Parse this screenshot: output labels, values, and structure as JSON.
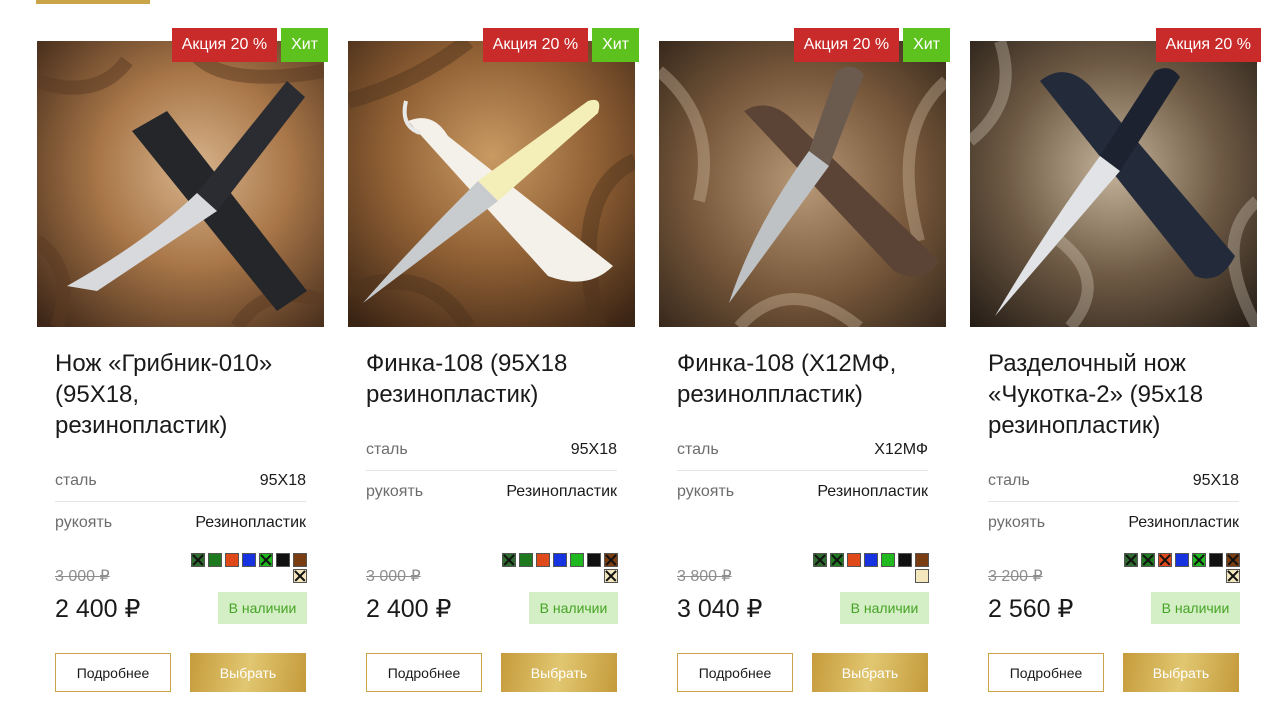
{
  "colors": {
    "accent": "#c9a449",
    "sale_badge": "#c92a2a",
    "hit_badge": "#5dc21e",
    "stock_bg": "#d4efc6",
    "stock_text": "#45a325"
  },
  "products": [
    {
      "badge_sale": "Акция 20 %",
      "badge_hit": "Хит",
      "image_icon": "knife-photo-icon",
      "title": "Нож «Грибник-010» (95Х18, резинопластик)",
      "specs": [
        {
          "name": "сталь",
          "value": "95Х18"
        },
        {
          "name": "рукоять",
          "value": "Резинопластик"
        }
      ],
      "swatches": [
        [
          "#2e6b2e",
          "#1f7a1f",
          "#e04a1a",
          "#1733e0",
          "#1fb81f",
          "#111111",
          "#7a3d12"
        ],
        [
          "#f3e6bd"
        ]
      ],
      "swatch_crossed": [
        [
          true,
          false,
          false,
          false,
          true,
          false,
          false
        ],
        [
          true
        ]
      ],
      "old_price": "3 000 ₽",
      "price": "2 400 ₽",
      "stock": "В наличии",
      "more_label": "Подробнее",
      "buy_label": "Выбрать"
    },
    {
      "badge_sale": "Акция 20 %",
      "badge_hit": "Хит",
      "image_icon": "knife-photo-icon",
      "title": "Финка-108 (95Х18 резинопластик)",
      "specs": [
        {
          "name": "сталь",
          "value": "95Х18"
        },
        {
          "name": "рукоять",
          "value": "Резинопластик"
        }
      ],
      "swatches": [
        [
          "#2e6b2e",
          "#1f7a1f",
          "#e04a1a",
          "#1733e0",
          "#1fb81f",
          "#111111",
          "#7a3d12"
        ],
        [
          "#f3e6bd"
        ]
      ],
      "swatch_crossed": [
        [
          true,
          false,
          false,
          false,
          false,
          false,
          true
        ],
        [
          true
        ]
      ],
      "old_price": "3 000 ₽",
      "price": "2 400 ₽",
      "stock": "В наличии",
      "more_label": "Подробнее",
      "buy_label": "Выбрать"
    },
    {
      "badge_sale": "Акция 20 %",
      "badge_hit": "Хит",
      "image_icon": "knife-photo-icon",
      "title": "Финка-108 (Х12МФ, резинолпластик)",
      "specs": [
        {
          "name": "сталь",
          "value": "Х12МФ"
        },
        {
          "name": "рукоять",
          "value": "Резинопластик"
        }
      ],
      "swatches": [
        [
          "#2e6b2e",
          "#1f7a1f",
          "#e04a1a",
          "#1733e0",
          "#1fb81f",
          "#111111",
          "#7a3d12"
        ],
        [
          "#f3e6bd"
        ]
      ],
      "swatch_crossed": [
        [
          true,
          true,
          false,
          false,
          false,
          false,
          false
        ],
        [
          false
        ]
      ],
      "old_price": "3 800 ₽",
      "price": "3 040 ₽",
      "stock": "В наличии",
      "more_label": "Подробнее",
      "buy_label": "Выбрать"
    },
    {
      "badge_sale": "Акция 20 %",
      "badge_hit": "",
      "image_icon": "knife-photo-icon",
      "title": "Разделочный нож «Чукотка-2» (95х18 резинопластик)",
      "specs": [
        {
          "name": "сталь",
          "value": "95Х18"
        },
        {
          "name": "рукоять",
          "value": "Резинопластик"
        }
      ],
      "swatches": [
        [
          "#2e6b2e",
          "#1f7a1f",
          "#e04a1a",
          "#1733e0",
          "#1fb81f",
          "#111111",
          "#7a3d12"
        ],
        [
          "#f3e6bd"
        ]
      ],
      "swatch_crossed": [
        [
          true,
          true,
          true,
          false,
          true,
          false,
          true
        ],
        [
          true
        ]
      ],
      "old_price": "3 200 ₽",
      "price": "2 560 ₽",
      "stock": "В наличии",
      "more_label": "Подробнее",
      "buy_label": "Выбрать"
    }
  ]
}
